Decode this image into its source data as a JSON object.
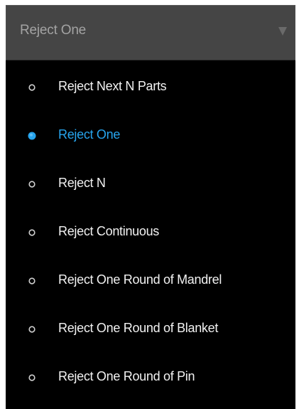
{
  "dropdown": {
    "selected_value": "Reject One",
    "arrow_icon": "caret-down-icon"
  },
  "options": [
    {
      "label": "Reject Next N Parts",
      "selected": false
    },
    {
      "label": "Reject One",
      "selected": true
    },
    {
      "label": "Reject N",
      "selected": false
    },
    {
      "label": "Reject Continuous",
      "selected": false
    },
    {
      "label": "Reject One Round of Mandrel",
      "selected": false
    },
    {
      "label": "Reject One Round of Blanket",
      "selected": false
    },
    {
      "label": "Reject One Round of Pin",
      "selected": false
    }
  ],
  "colors": {
    "panel_background": "#000000",
    "header_background": "#454545",
    "header_text": "#a3a3a3",
    "option_text": "#f2f2f2",
    "selected_accent": "#27a5ee",
    "radio_outline": "#d0d0d0"
  }
}
